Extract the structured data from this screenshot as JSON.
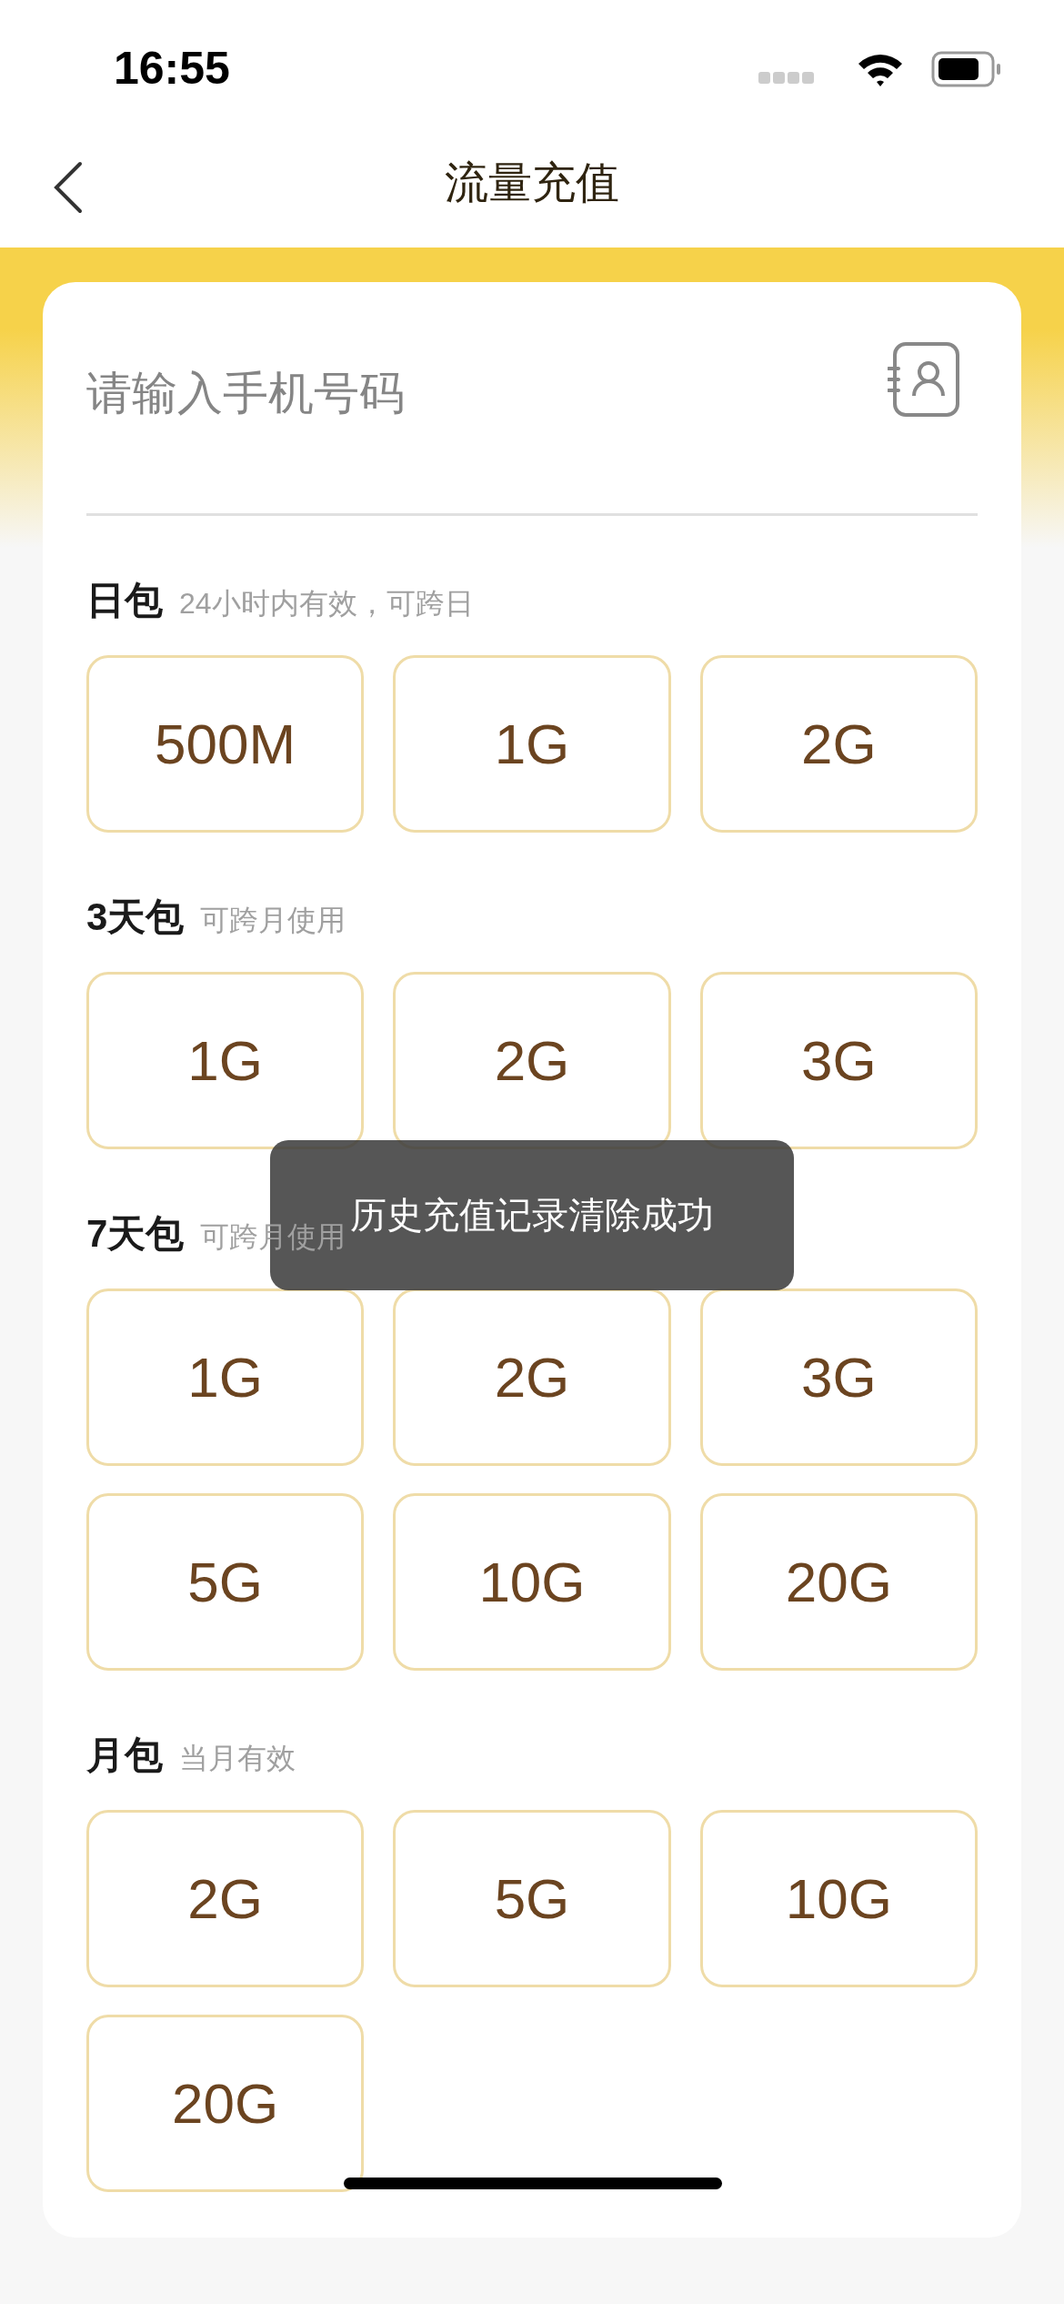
{
  "status_bar": {
    "time": "16:55"
  },
  "nav": {
    "title": "流量充值"
  },
  "phone_field": {
    "placeholder": "请输入手机号码"
  },
  "sections": [
    {
      "title": "日包",
      "hint": "24小时内有效，可跨日",
      "options": [
        "500M",
        "1G",
        "2G"
      ]
    },
    {
      "title": "3天包",
      "hint": "可跨月使用",
      "options": [
        "1G",
        "2G",
        "3G"
      ]
    },
    {
      "title": "7天包",
      "hint": "可跨月使用",
      "options": [
        "1G",
        "2G",
        "3G",
        "5G",
        "10G",
        "20G"
      ]
    },
    {
      "title": "月包",
      "hint": "当月有效",
      "options": [
        "2G",
        "5G",
        "10G",
        "20G"
      ]
    }
  ],
  "toast": "历史充值记录清除成功"
}
